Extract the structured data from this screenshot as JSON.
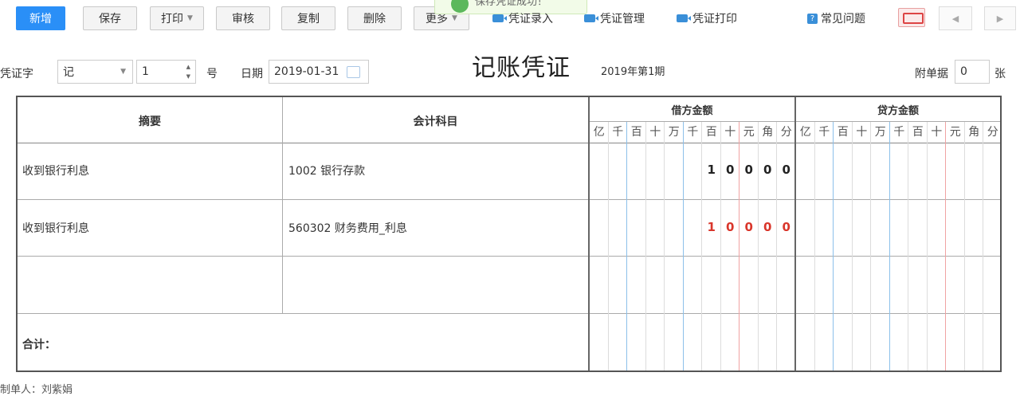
{
  "toolbar": {
    "new_label": "新增",
    "save_label": "保存",
    "print_label": "打印",
    "audit_label": "审核",
    "copy_label": "复制",
    "delete_label": "删除",
    "more_label": "更多",
    "voucher_entry": "凭证录入",
    "voucher_manage": "凭证管理",
    "voucher_print": "凭证打印",
    "faq": "常见问题"
  },
  "toast": {
    "message": "保存凭证成功！"
  },
  "form": {
    "voucher_word_label": "凭证字",
    "voucher_word_value": "记",
    "number_value": "1",
    "number_suffix": "号",
    "date_label": "日期",
    "date_value": "2019-01-31",
    "title": "记账凭证",
    "period": "2019年第1期",
    "attachment_label": "附单据",
    "attachment_value": "0",
    "attachment_suffix": "张"
  },
  "table": {
    "col_summary": "摘要",
    "col_subject": "会计科目",
    "col_debit": "借方金额",
    "col_credit": "贷方金额",
    "units": [
      "亿",
      "千",
      "百",
      "十",
      "万",
      "千",
      "百",
      "十",
      "元",
      "角",
      "分"
    ],
    "rows": [
      {
        "summary": "收到银行利息",
        "subject": "1002 银行存款",
        "debit_digits": [
          "1",
          "0",
          "0",
          "0",
          "0"
        ],
        "debit_color": "#222222"
      },
      {
        "summary": "收到银行利息",
        "subject": "560302 财务费用_利息",
        "debit_digits": [
          "1",
          "0",
          "0",
          "0",
          "0"
        ],
        "debit_color": "#d9362b"
      },
      {
        "summary": "",
        "subject": "",
        "debit_digits": [],
        "debit_color": "#222222"
      }
    ],
    "total_label": "合计："
  },
  "footer": {
    "text": "制单人：刘紫娟"
  }
}
